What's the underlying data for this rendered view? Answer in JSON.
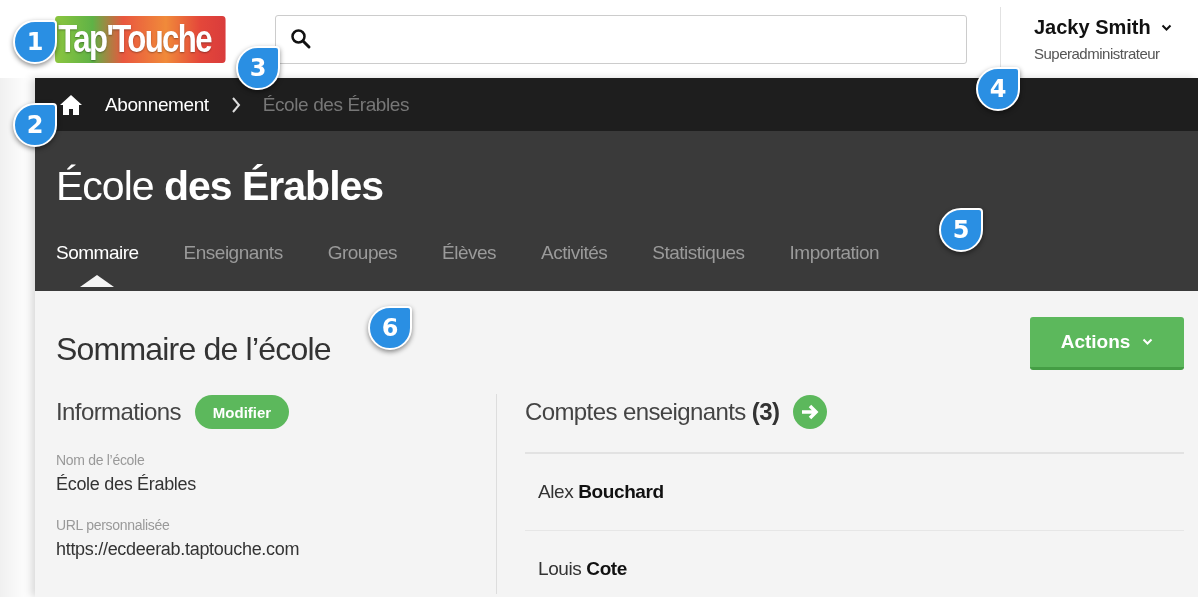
{
  "header": {
    "logo": "Tap'Touche",
    "user": {
      "name": "Jacky Smith",
      "role": "Superadministrateur"
    }
  },
  "breadcrumb": [
    {
      "label": "Abonnement",
      "current": false
    },
    {
      "label": "École des Érables",
      "current": true
    }
  ],
  "school": {
    "title": "École **des Érables**"
  },
  "tabs": [
    {
      "label": "Sommaire",
      "selected": true
    },
    {
      "label": "Enseignants",
      "selected": false
    },
    {
      "label": "Groupes",
      "selected": false
    },
    {
      "label": "Élèves",
      "selected": false
    },
    {
      "label": "Activités",
      "selected": false
    },
    {
      "label": "Statistiques",
      "selected": false
    },
    {
      "label": "Importation",
      "selected": false
    }
  ],
  "summary": {
    "title": "Sommaire de l’école",
    "actions_button": "Actions",
    "informations": {
      "title": "Informations",
      "edit_button": "Modifier",
      "fields": [
        {
          "label": "Nom de l’école",
          "value": "École des Érables"
        },
        {
          "label": "URL personnalisée",
          "value": "https://ecdeerab.taptouche.com"
        }
      ]
    },
    "teachers": {
      "title": "Comptes enseignants **(3)**",
      "rows": [
        {
          "name": "Alex **Bouchard**"
        },
        {
          "name": "Louis **Cote**"
        }
      ]
    }
  },
  "callouts": [
    "1",
    "2",
    "3",
    "4",
    "5",
    "6"
  ]
}
